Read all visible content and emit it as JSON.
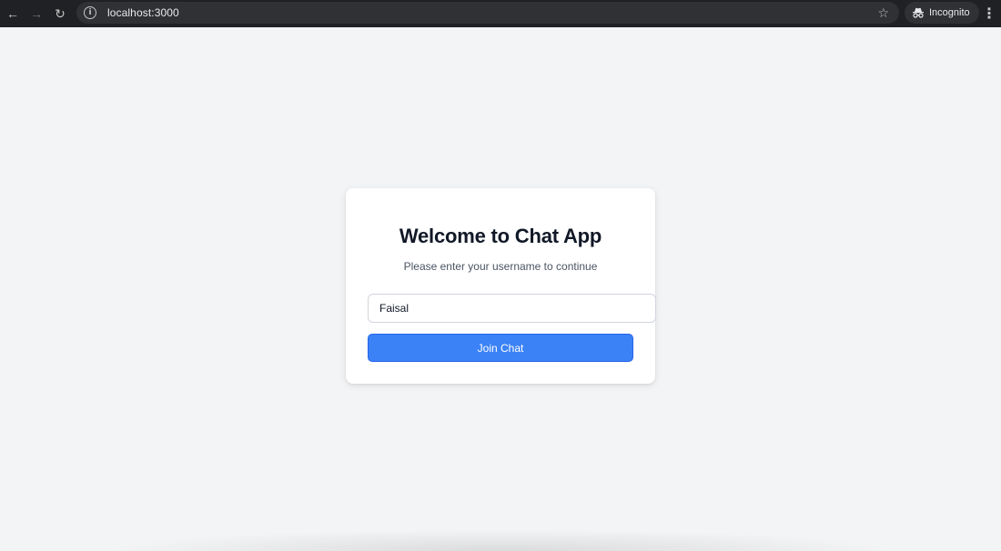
{
  "browser": {
    "url": "localhost:3000",
    "incognito_label": "Incognito",
    "back_glyph": "←",
    "forward_glyph": "→",
    "reload_glyph": "↻",
    "star_glyph": "☆",
    "menu_glyph": "⋮",
    "site_info_glyph": "i"
  },
  "login": {
    "title": "Welcome to Chat App",
    "subtitle": "Please enter your username to continue",
    "username_value": "Faisal",
    "join_label": "Join Chat"
  },
  "colors": {
    "page_background": "#f3f4f6",
    "card_background": "#ffffff",
    "primary_button": "#3b82f6",
    "browser_toolbar": "#202124"
  }
}
